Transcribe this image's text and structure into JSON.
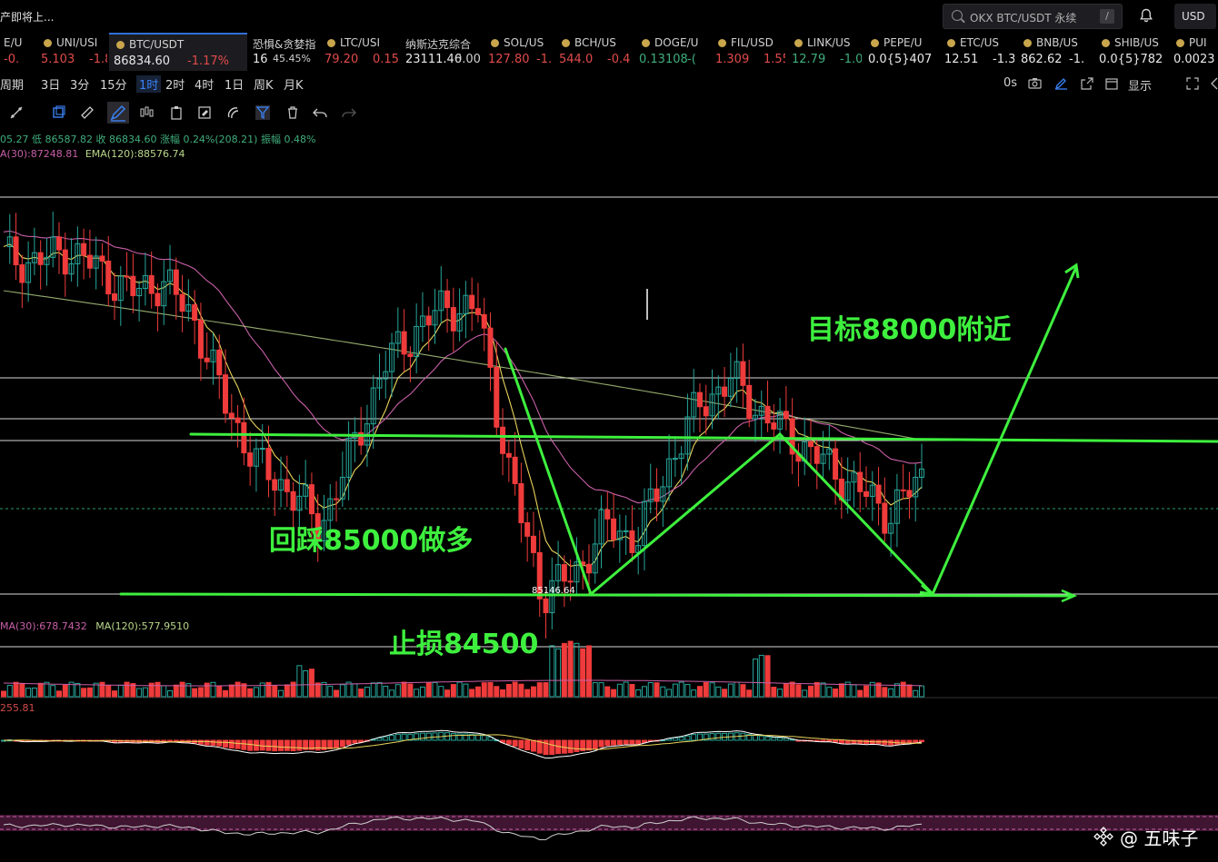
{
  "topbar": {
    "notice": "产即将上...",
    "search_text": "OKX BTC/USDT 永续",
    "search_hint": "/",
    "currency": "USD"
  },
  "tickers": [
    {
      "name": "E/U",
      "price": "-0.",
      "change": "",
      "color": "#e24a4a",
      "dot": false
    },
    {
      "name": "UNI/USI",
      "price": "5.103",
      "change": "-1.8",
      "color": "#e24a4a",
      "dot": true
    },
    {
      "name": "BTC/USDT",
      "price": "86834.60",
      "change": "-1.17%",
      "color": "#e24a4a",
      "dot": true
    },
    {
      "name": "恐惧&贪婪指",
      "price": "16",
      "change": "45.45%",
      "color": "#d0d0d0",
      "dot": false
    },
    {
      "name": "LTC/USI",
      "price": "79.20",
      "change": "0.15",
      "color": "#e24a4a",
      "dot": true
    },
    {
      "name": "纳斯达克综合",
      "price": "23111.46",
      "change": "0.00",
      "color": "#d0d0d0",
      "dot": false
    },
    {
      "name": "SOL/US",
      "price": "127.80",
      "change": "-1.",
      "color": "#e24a4a",
      "dot": true
    },
    {
      "name": "BCH/US",
      "price": "544.0",
      "change": "-0.4",
      "color": "#e24a4a",
      "dot": true
    },
    {
      "name": "DOGE/U",
      "price": "0.13108",
      "change": "-(",
      "color": "#3fae7c",
      "dot": true
    },
    {
      "name": "FIL/USD",
      "price": "1.309",
      "change": "1.55",
      "color": "#e24a4a",
      "dot": true
    },
    {
      "name": "LINK/US",
      "price": "12.79",
      "change": "-1.0",
      "color": "#3fae7c",
      "dot": true
    },
    {
      "name": "PEPE/U",
      "price": "0.0{5}407",
      "change": "",
      "color": "#e8e8e8",
      "dot": true
    },
    {
      "name": "ETC/US",
      "price": "12.51",
      "change": "-1.3",
      "color": "#e8e8e8",
      "dot": true
    },
    {
      "name": "BNB/US",
      "price": "862.62",
      "change": "-1.",
      "color": "#e8e8e8",
      "dot": true
    },
    {
      "name": "SHIB/US",
      "price": "0.0{5}782",
      "change": "",
      "color": "#e8e8e8",
      "dot": true
    },
    {
      "name": "PUI",
      "price": "0.0023",
      "change": "",
      "color": "#e8e8e8",
      "dot": true
    }
  ],
  "periods": [
    "周期",
    "3日",
    "3分",
    "15分",
    "1时",
    "2时",
    "4时",
    "1日",
    "周K",
    "月K"
  ],
  "active_period": "1时",
  "right_tools": {
    "countdown": "0s",
    "display": "显示"
  },
  "ohlc_line": "05.27 低 86587.82 收 86834.60 涨幅 0.24%(208.21) 振幅 0.48%",
  "ema_line": {
    "ema30": "A(30):87248.81",
    "ema120": "EMA(120):88576.74"
  },
  "vol_line": {
    "ma30": "MA(30):678.7432",
    "ma120": "MA(120):577.9510"
  },
  "macd_value": "255.81",
  "annotations": {
    "target": "目标88000附近",
    "long": "回踩85000做多",
    "stop": "止损84500",
    "low_label": "85146.64"
  },
  "watermark": "@ 五味子",
  "colors": {
    "up": "#26a69a",
    "down": "#ef3b3b",
    "annotation": "#3ef03e",
    "active": "#3b82f6"
  },
  "chart_data": {
    "type": "candlestick",
    "symbol": "BTC/USDT",
    "interval": "1时",
    "low_marker": 85146.64,
    "target": 88000,
    "entry": 85000,
    "stop_loss": 84500,
    "path": [
      87900,
      87850,
      87950,
      87800,
      87600,
      87700,
      87400,
      86700,
      86200,
      86000,
      85700,
      86300,
      87000,
      87300,
      87500,
      87450,
      86100,
      85150,
      85300,
      85700,
      85600,
      86200,
      86700,
      86900,
      86600,
      86400,
      86200,
      86000,
      85800,
      86100
    ]
  }
}
